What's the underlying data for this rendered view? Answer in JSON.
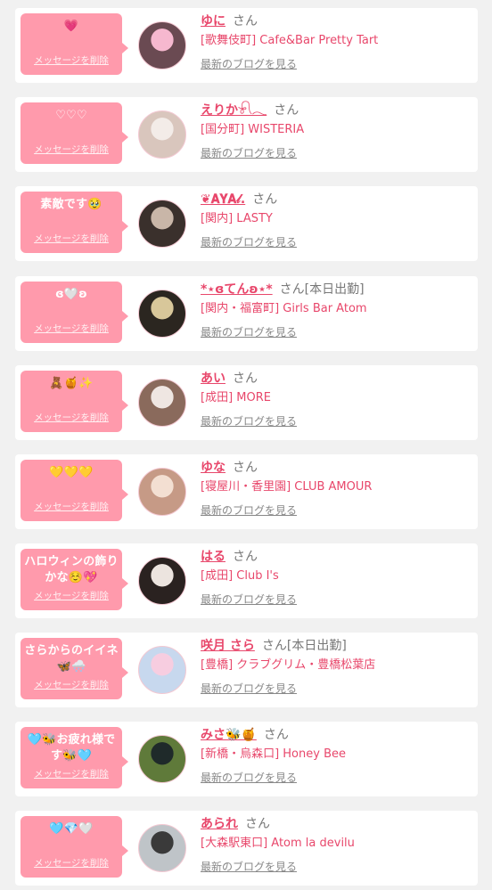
{
  "items": [
    {
      "message": "💗",
      "delete_label": "メッセージを削除",
      "name": "ゆに",
      "honorific": "さん",
      "shop": "[歌舞伎町] Cafe&Bar Pretty Tart",
      "blog_link": "最新のブログを見る",
      "avatar_colors": [
        "#f6b8cf",
        "#6a4a52"
      ]
    },
    {
      "message": "♡♡♡",
      "delete_label": "メッセージを削除",
      "name": "えりか𓍯𓂃",
      "honorific": "さん",
      "shop": "[国分町] WISTERIA",
      "blog_link": "最新のブログを見る",
      "avatar_colors": [
        "#f3ece8",
        "#d9c6bd"
      ]
    },
    {
      "message": "素敵です🥹",
      "delete_label": "メッセージを削除",
      "name": "❦𝐀𝐘𝐀𝓁.",
      "honorific": "さん",
      "shop": "[関内] LASTY",
      "blog_link": "最新のブログを見る",
      "avatar_colors": [
        "#c9b6a8",
        "#3a302c"
      ]
    },
    {
      "message": "ɞ🤍ʚ",
      "delete_label": "メッセージを削除",
      "name": "*⋆ɞてんʚ⋆*",
      "honorific": "さん",
      "status": "[本日出勤]",
      "shop": "[関内・福富町] Girls Bar Atom",
      "blog_link": "最新のブログを見る",
      "avatar_colors": [
        "#d8c79a",
        "#2b2620"
      ]
    },
    {
      "message": "🧸🍯✨",
      "delete_label": "メッセージを削除",
      "name": "あい",
      "honorific": "さん",
      "shop": "[成田] MORE",
      "blog_link": "最新のブログを見る",
      "avatar_colors": [
        "#efe6e2",
        "#8a6a5c"
      ]
    },
    {
      "message": "💛💛💛",
      "delete_label": "メッセージを削除",
      "name": "ゆな",
      "honorific": "さん",
      "shop": "[寝屋川・香里園] CLUB AMOUR",
      "blog_link": "最新のブログを見る",
      "avatar_colors": [
        "#f3dfd2",
        "#c69a86"
      ]
    },
    {
      "message": "ハロウィンの飾りかな☺️💖",
      "delete_label": "メッセージを削除",
      "name": "はる",
      "honorific": "さん",
      "shop": "[成田] Club I's",
      "blog_link": "最新のブログを見る",
      "avatar_colors": [
        "#ece4df",
        "#2a2220"
      ]
    },
    {
      "message": "さらからのイイネ🦋🌨️",
      "delete_label": "メッセージを削除",
      "name": "咲月 さら",
      "honorific": "さん",
      "status": "[本日出勤]",
      "shop": "[豊橋] クラブグリム・豊橋松葉店",
      "blog_link": "最新のブログを見る",
      "avatar_colors": [
        "#f7cde0",
        "#c7d8ee"
      ]
    },
    {
      "message": "🩵🐝お疲れ様です🐝🩵",
      "delete_label": "メッセージを削除",
      "name": "みさ🐝🍯",
      "honorific": "さん",
      "shop": "[新橋・烏森口] Honey Bee",
      "blog_link": "最新のブログを見る",
      "avatar_colors": [
        "#1f2a2a",
        "#5f7a3a"
      ]
    },
    {
      "message": "🩵💎🤍",
      "delete_label": "メッセージを削除",
      "name": "あられ",
      "honorific": "さん",
      "shop": "[大森駅東口] Atom la devilu",
      "blog_link": "最新のブログを見る",
      "avatar_colors": [
        "#3a3a3a",
        "#bfc4c8"
      ]
    }
  ]
}
